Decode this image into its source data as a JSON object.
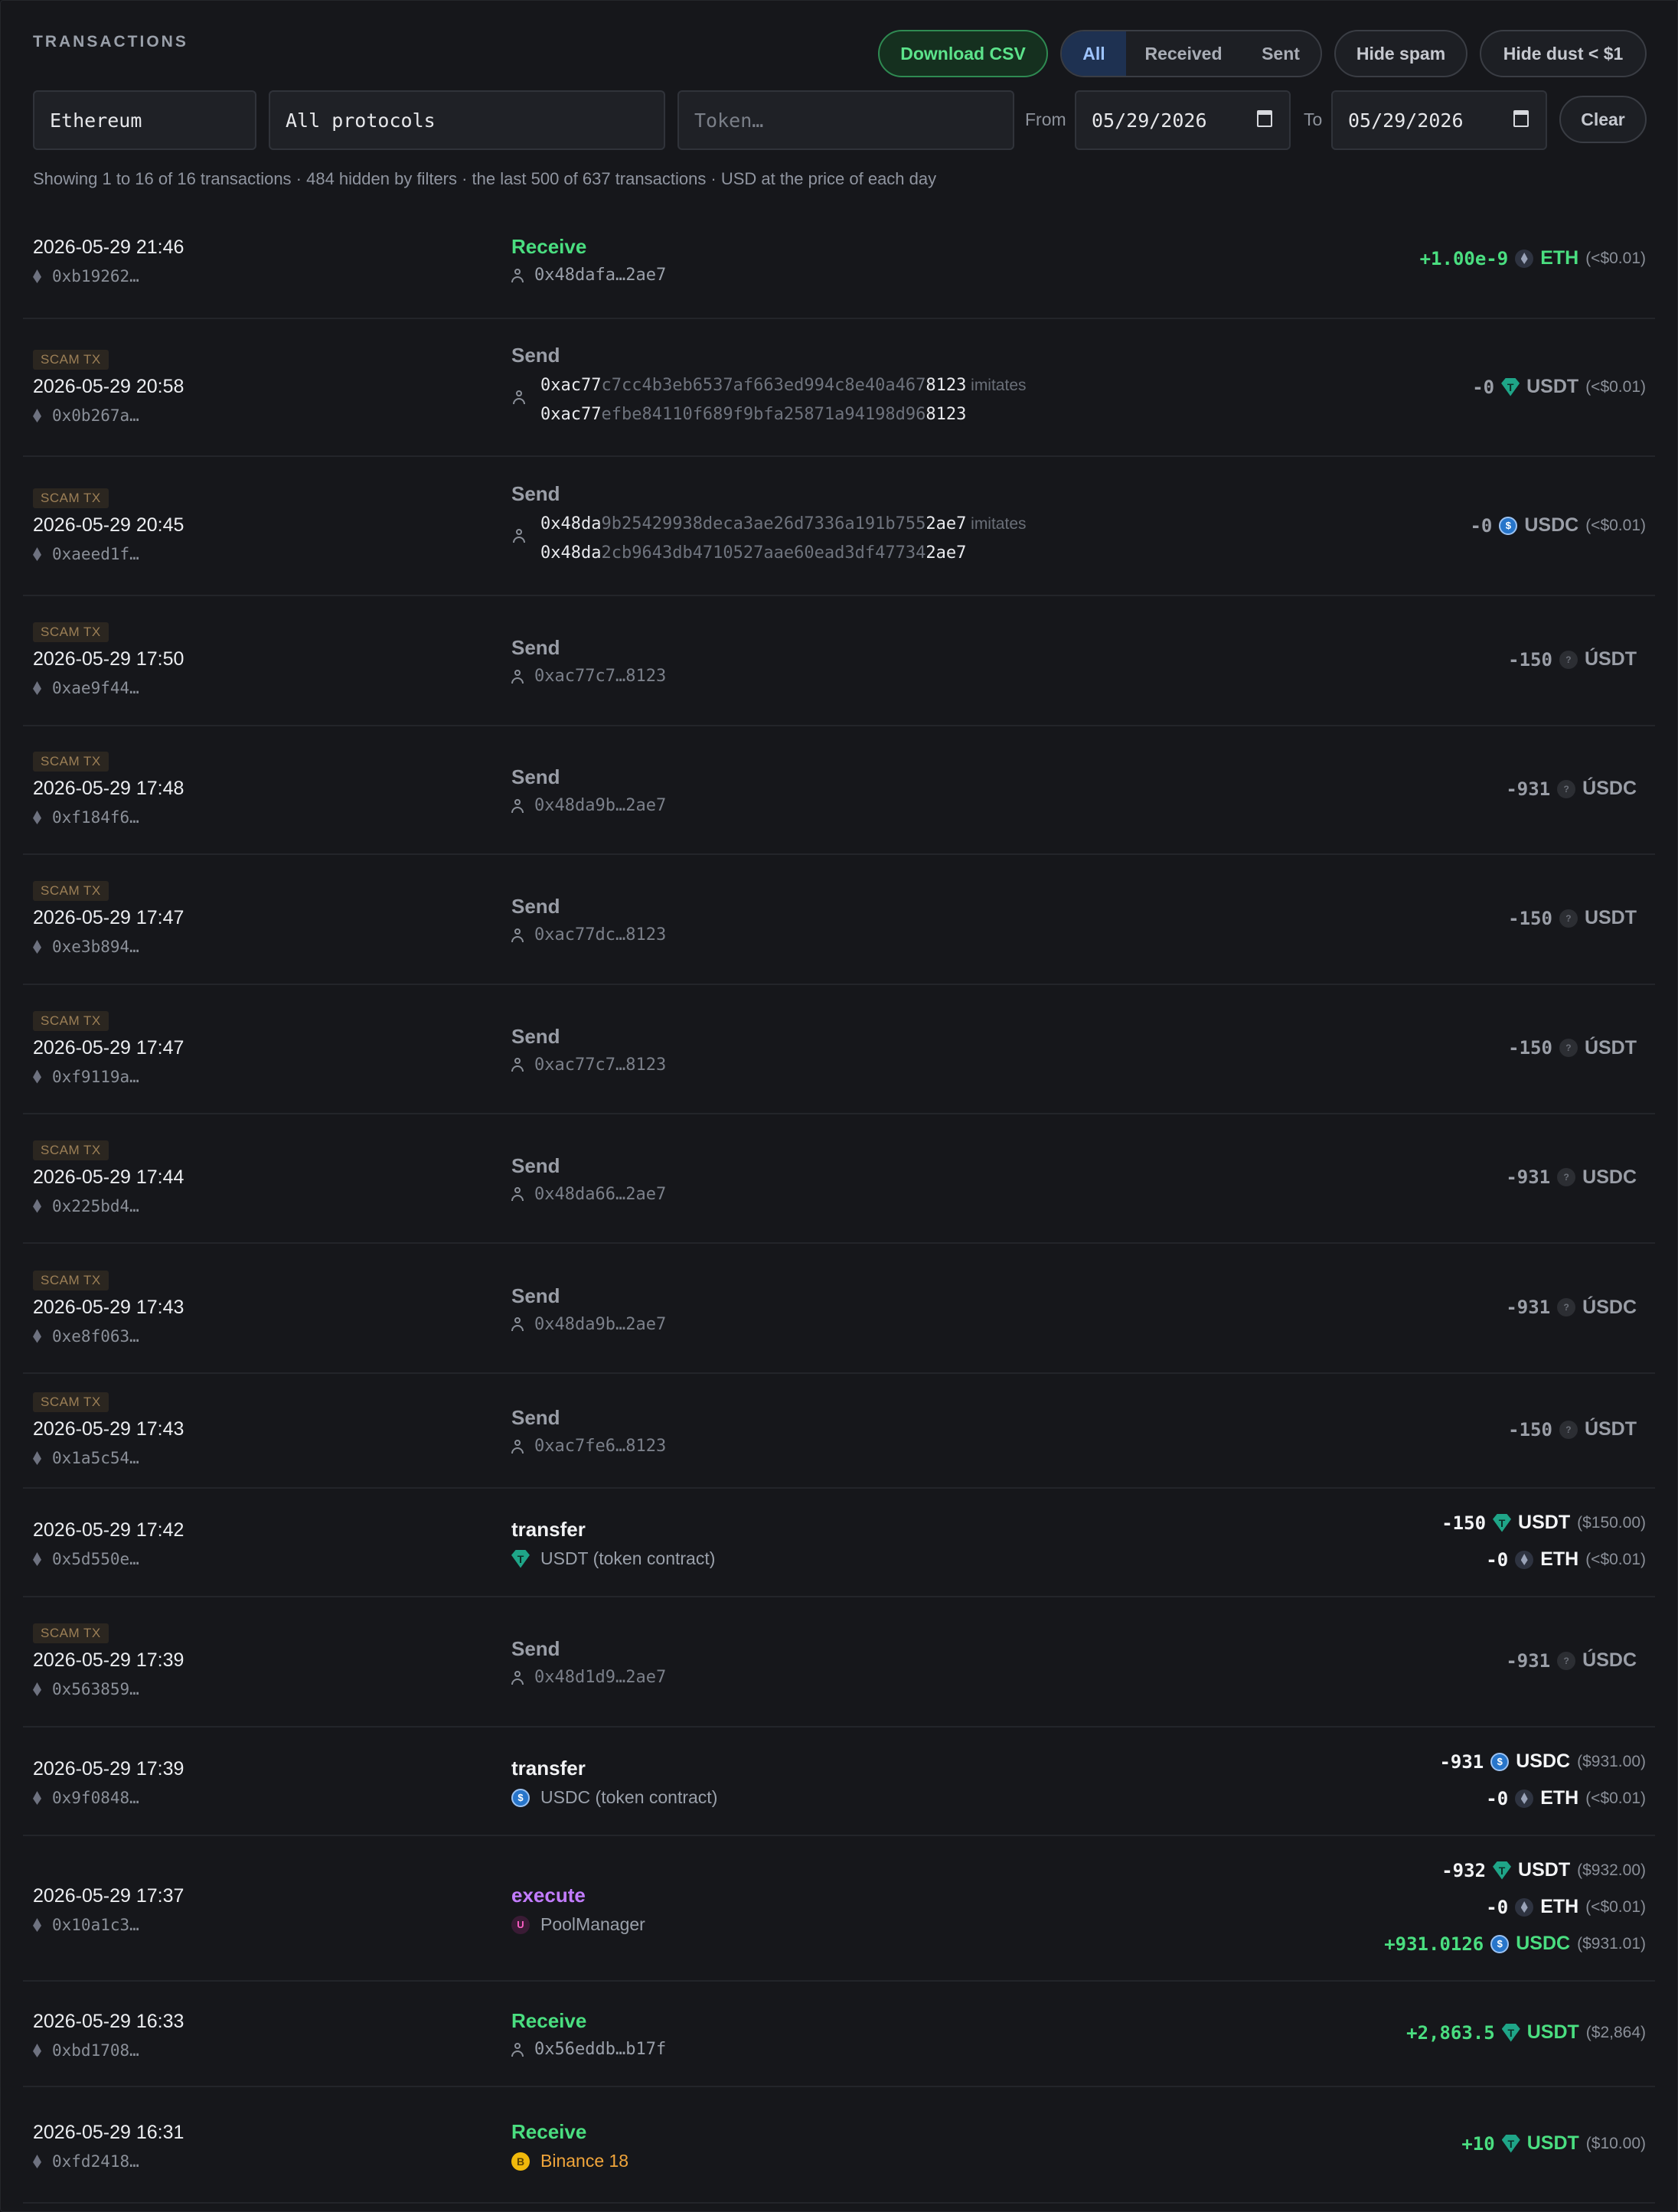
{
  "header": {
    "title": "TRANSACTIONS",
    "download_label": "Download CSV",
    "filter_tabs": [
      "All",
      "Received",
      "Sent"
    ],
    "active_tab": "All",
    "hide_spam_label": "Hide spam",
    "hide_dust_label": "Hide dust < $1"
  },
  "filters": {
    "chain": "Ethereum",
    "protocol": "All protocols",
    "token_placeholder": "Token…",
    "from_label": "From",
    "from_date": "05/29/2026",
    "to_label": "To",
    "to_date": "05/29/2026",
    "clear_label": "Clear"
  },
  "summary": "Showing 1 to 16 of 16 transactions · 484 hidden by filters · the last 500 of 637 transactions · USD at the price of each day",
  "colors": {
    "positive": "#4ade80",
    "accent": "#9ec4ff",
    "scam_badge": "#9c7f56",
    "execute": "#c27cff"
  },
  "scam_badge_label": "SCAM TX",
  "imitates_label": "imitates",
  "rows": [
    {
      "datetime": "2026-05-29 21:46",
      "hash": "0xb19262…",
      "action": "Receive",
      "counterparty": "0x48dafa…2ae7",
      "amounts": [
        {
          "value": "+1.00e-9",
          "symbol": "ETH",
          "usd": "(<$0.01)"
        }
      ]
    },
    {
      "scam": true,
      "datetime": "2026-05-29 20:58",
      "hash": "0x0b267a…",
      "action": "Send",
      "imitation": {
        "fake_start": "0xac77",
        "fake_mid": "c7cc4b3eb6537af663ed994c8e40a467",
        "fake_end": "8123",
        "real_start": "0xac77",
        "real_mid": "efbe84110f689f9bfa25871a94198d96",
        "real_end": "8123"
      },
      "amounts": [
        {
          "value": "-0",
          "symbol": "USDT",
          "usd": "(<$0.01)"
        }
      ]
    },
    {
      "scam": true,
      "datetime": "2026-05-29 20:45",
      "hash": "0xaeed1f…",
      "action": "Send",
      "imitation": {
        "fake_start": "0x48da",
        "fake_mid": "9b25429938deca3ae26d7336a191b755",
        "fake_end": "2ae7",
        "real_start": "0x48da",
        "real_mid": "2cb9643db4710527aae60ead3df47734",
        "real_end": "2ae7"
      },
      "amounts": [
        {
          "value": "-0",
          "symbol": "USDC",
          "usd": "(<$0.01)"
        }
      ]
    },
    {
      "scam": true,
      "datetime": "2026-05-29 17:50",
      "hash": "0xae9f44…",
      "action": "Send",
      "counterparty": "0xac77c7…8123",
      "amounts": [
        {
          "value": "-150",
          "symbol": "ÚSDT",
          "usd": ""
        }
      ]
    },
    {
      "scam": true,
      "datetime": "2026-05-29 17:48",
      "hash": "0xf184f6…",
      "action": "Send",
      "counterparty": "0x48da9b…2ae7",
      "amounts": [
        {
          "value": "-931",
          "symbol": "ÚSDC",
          "usd": ""
        }
      ]
    },
    {
      "scam": true,
      "datetime": "2026-05-29 17:47",
      "hash": "0xe3b894…",
      "action": "Send",
      "counterparty": "0xac77dc…8123",
      "amounts": [
        {
          "value": "-150",
          "symbol": "USDT",
          "usd": ""
        }
      ]
    },
    {
      "scam": true,
      "datetime": "2026-05-29 17:47",
      "hash": "0xf9119a…",
      "action": "Send",
      "counterparty": "0xac77c7…8123",
      "amounts": [
        {
          "value": "-150",
          "symbol": "ÚSDT",
          "usd": ""
        }
      ]
    },
    {
      "scam": true,
      "datetime": "2026-05-29 17:44",
      "hash": "0x225bd4…",
      "action": "Send",
      "counterparty": "0x48da66…2ae7",
      "amounts": [
        {
          "value": "-931",
          "symbol": "USDC",
          "usd": ""
        }
      ]
    },
    {
      "scam": true,
      "datetime": "2026-05-29 17:43",
      "hash": "0xe8f063…",
      "action": "Send",
      "counterparty": "0x48da9b…2ae7",
      "amounts": [
        {
          "value": "-931",
          "symbol": "ÚSDC",
          "usd": ""
        }
      ]
    },
    {
      "scam": true,
      "datetime": "2026-05-29 17:43",
      "hash": "0x1a5c54…",
      "action": "Send",
      "counterparty": "0xac7fe6…8123",
      "amounts": [
        {
          "value": "-150",
          "symbol": "ÚSDT",
          "usd": ""
        }
      ]
    },
    {
      "datetime": "2026-05-29 17:42",
      "hash": "0x5d550e…",
      "action": "transfer",
      "counterparty": "USDT (token contract)",
      "amounts": [
        {
          "value": "-150",
          "symbol": "USDT",
          "usd": "($150.00)"
        },
        {
          "value": "-0",
          "symbol": "ETH",
          "usd": "(<$0.01)"
        }
      ]
    },
    {
      "scam": true,
      "datetime": "2026-05-29 17:39",
      "hash": "0x563859…",
      "action": "Send",
      "counterparty": "0x48d1d9…2ae7",
      "amounts": [
        {
          "value": "-931",
          "symbol": "ÚSDC",
          "usd": ""
        }
      ]
    },
    {
      "datetime": "2026-05-29 17:39",
      "hash": "0x9f0848…",
      "action": "transfer",
      "counterparty": "USDC (token contract)",
      "amounts": [
        {
          "value": "-931",
          "symbol": "USDC",
          "usd": "($931.00)"
        },
        {
          "value": "-0",
          "symbol": "ETH",
          "usd": "(<$0.01)"
        }
      ]
    },
    {
      "datetime": "2026-05-29 17:37",
      "hash": "0x10a1c3…",
      "action": "execute",
      "counterparty": "PoolManager",
      "amounts": [
        {
          "value": "-932",
          "symbol": "USDT",
          "usd": "($932.00)"
        },
        {
          "value": "-0",
          "symbol": "ETH",
          "usd": "(<$0.01)"
        },
        {
          "value": "+931.0126",
          "symbol": "USDC",
          "usd": "($931.01)"
        }
      ]
    },
    {
      "datetime": "2026-05-29 16:33",
      "hash": "0xbd1708…",
      "action": "Receive",
      "counterparty": "0x56eddb…b17f",
      "amounts": [
        {
          "value": "+2,863.5",
          "symbol": "USDT",
          "usd": "($2,864)"
        }
      ]
    },
    {
      "datetime": "2026-05-29 16:31",
      "hash": "0xfd2418…",
      "action": "Receive",
      "counterparty": "Binance 18",
      "amounts": [
        {
          "value": "+10",
          "symbol": "USDT",
          "usd": "($10.00)"
        }
      ]
    }
  ]
}
